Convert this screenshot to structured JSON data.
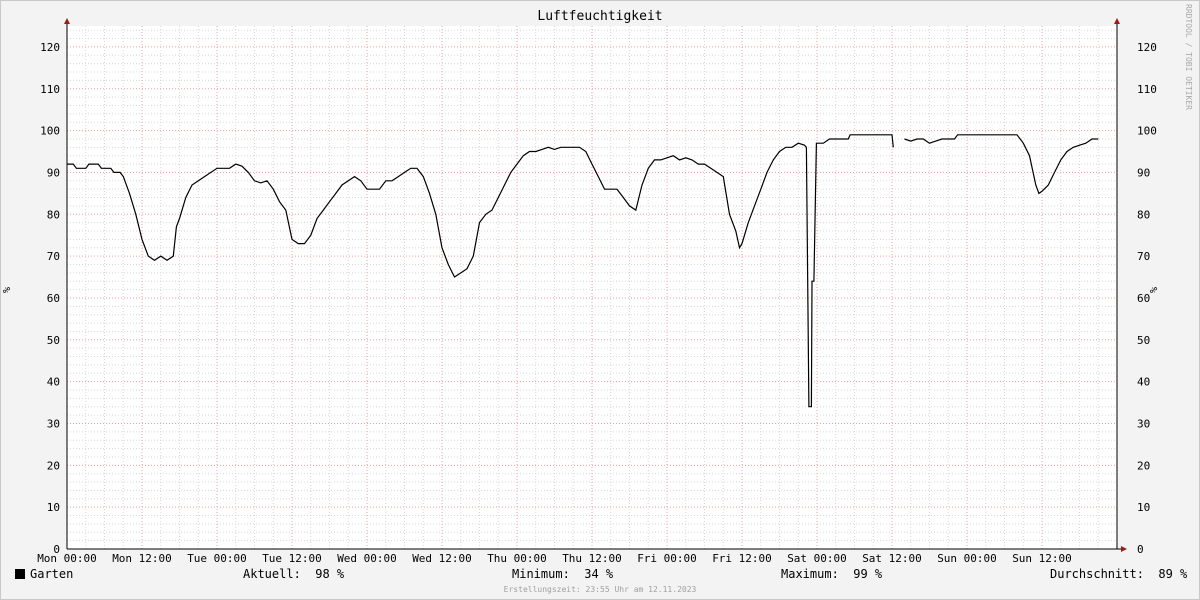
{
  "chart_data": {
    "type": "line",
    "title": "Luftfeuchtigkeit",
    "ylabel_left": "%",
    "ylabel_right": "%",
    "watermark": "RRDTOOL / TOBI OETIKER",
    "ylim": [
      0,
      125
    ],
    "yticks": [
      "0",
      "10",
      "20",
      "30",
      "40",
      "50",
      "60",
      "70",
      "80",
      "90",
      "100",
      "110",
      "120"
    ],
    "x_unit": "hours since Mon 00:00",
    "xlim": [
      0,
      168
    ],
    "xticks": [
      {
        "label": "Mon 00:00",
        "h": 0
      },
      {
        "label": "Mon 12:00",
        "h": 12
      },
      {
        "label": "Tue 00:00",
        "h": 24
      },
      {
        "label": "Tue 12:00",
        "h": 36
      },
      {
        "label": "Wed 00:00",
        "h": 48
      },
      {
        "label": "Wed 12:00",
        "h": 60
      },
      {
        "label": "Thu 00:00",
        "h": 72
      },
      {
        "label": "Thu 12:00",
        "h": 84
      },
      {
        "label": "Fri 00:00",
        "h": 96
      },
      {
        "label": "Fri 12:00",
        "h": 108
      },
      {
        "label": "Sat 00:00",
        "h": 120
      },
      {
        "label": "Sat 12:00",
        "h": 132
      },
      {
        "label": "Sun 00:00",
        "h": 144
      },
      {
        "label": "Sun 12:00",
        "h": 156
      }
    ],
    "grid": true,
    "line_color": "#000000",
    "series": [
      {
        "name": "Garten",
        "segments": [
          [
            [
              0,
              92
            ],
            [
              1,
              92
            ],
            [
              1.5,
              91
            ],
            [
              3,
              91
            ],
            [
              3.5,
              92
            ],
            [
              5,
              92
            ],
            [
              5.5,
              91
            ],
            [
              7,
              91
            ],
            [
              7.5,
              90
            ],
            [
              8.5,
              90
            ],
            [
              9,
              89
            ],
            [
              10,
              85
            ],
            [
              11,
              80
            ],
            [
              12,
              74
            ],
            [
              13,
              70
            ],
            [
              14,
              69
            ],
            [
              15,
              70
            ],
            [
              16,
              69
            ],
            [
              17,
              70
            ],
            [
              17.5,
              77
            ],
            [
              18,
              79
            ],
            [
              19,
              84
            ],
            [
              20,
              87
            ],
            [
              22,
              89
            ],
            [
              24,
              91
            ],
            [
              26,
              91
            ],
            [
              27,
              92
            ],
            [
              28,
              91.5
            ],
            [
              29,
              90
            ],
            [
              30,
              88
            ],
            [
              31,
              87.5
            ],
            [
              32,
              88
            ],
            [
              33,
              86
            ],
            [
              34,
              83
            ],
            [
              35,
              81
            ],
            [
              36,
              74
            ],
            [
              37,
              73
            ],
            [
              38,
              73
            ],
            [
              39,
              75
            ],
            [
              40,
              79
            ],
            [
              41,
              81
            ],
            [
              42,
              83
            ],
            [
              43,
              85
            ],
            [
              44,
              87
            ],
            [
              45,
              88
            ],
            [
              46,
              89
            ],
            [
              47,
              88
            ],
            [
              48,
              86
            ],
            [
              49,
              86
            ],
            [
              50,
              86
            ],
            [
              51,
              88
            ],
            [
              52,
              88
            ],
            [
              53,
              89
            ],
            [
              54,
              90
            ],
            [
              55,
              91
            ],
            [
              56,
              91
            ],
            [
              57,
              89
            ],
            [
              58,
              85
            ],
            [
              59,
              80
            ],
            [
              60,
              72
            ],
            [
              61,
              68
            ],
            [
              62,
              65
            ],
            [
              63,
              66
            ],
            [
              64,
              67
            ],
            [
              65,
              70
            ],
            [
              66,
              78
            ],
            [
              67,
              80
            ],
            [
              68,
              81
            ],
            [
              69,
              84
            ],
            [
              70,
              87
            ],
            [
              71,
              90
            ],
            [
              72,
              92
            ],
            [
              73,
              94
            ],
            [
              74,
              95
            ],
            [
              75,
              95
            ],
            [
              76,
              95.5
            ],
            [
              77,
              96
            ],
            [
              78,
              95.5
            ],
            [
              79,
              96
            ],
            [
              80,
              96
            ],
            [
              81,
              96
            ],
            [
              82,
              96
            ],
            [
              83,
              95
            ],
            [
              84,
              92
            ],
            [
              85,
              89
            ],
            [
              86,
              86
            ],
            [
              87,
              86
            ],
            [
              88,
              86
            ],
            [
              89,
              84
            ],
            [
              90,
              82
            ],
            [
              91,
              81
            ],
            [
              92,
              87
            ],
            [
              93,
              91
            ],
            [
              94,
              93
            ],
            [
              95,
              93
            ],
            [
              96,
              93.5
            ],
            [
              97,
              94
            ],
            [
              98,
              93
            ],
            [
              99,
              93.5
            ],
            [
              100,
              93
            ],
            [
              101,
              92
            ],
            [
              102,
              92
            ],
            [
              103,
              91
            ],
            [
              104,
              90
            ],
            [
              105,
              89
            ],
            [
              106,
              80
            ],
            [
              107,
              76
            ],
            [
              107.6,
              72
            ],
            [
              108,
              73
            ],
            [
              109,
              78
            ],
            [
              110,
              82
            ],
            [
              111,
              86
            ],
            [
              112,
              90
            ],
            [
              113,
              93
            ],
            [
              114,
              95
            ],
            [
              115,
              96
            ],
            [
              116,
              96
            ],
            [
              117,
              97
            ],
            [
              118,
              96.5
            ],
            [
              118.3,
              96
            ],
            [
              118.7,
              34
            ],
            [
              119.1,
              34
            ],
            [
              119.2,
              64
            ],
            [
              119.5,
              64
            ],
            [
              119.9,
              97
            ],
            [
              120.5,
              97
            ],
            [
              121,
              97
            ],
            [
              122,
              98
            ],
            [
              123,
              98
            ],
            [
              124,
              98
            ],
            [
              125,
              98
            ],
            [
              125.3,
              99
            ],
            [
              127,
              99
            ],
            [
              129,
              99
            ],
            [
              131,
              99
            ],
            [
              132,
              99
            ],
            [
              132.2,
              96
            ]
          ],
          [
            [
              134,
              98
            ],
            [
              135,
              97.5
            ],
            [
              136,
              98
            ],
            [
              137,
              98
            ],
            [
              138,
              97
            ],
            [
              139,
              97.5
            ],
            [
              140,
              98
            ],
            [
              141,
              98
            ],
            [
              142,
              98
            ],
            [
              142.5,
              99
            ],
            [
              145,
              99
            ],
            [
              148,
              99
            ],
            [
              151,
              99
            ],
            [
              152,
              99
            ],
            [
              153,
              97
            ],
            [
              154,
              94
            ],
            [
              155,
              87
            ],
            [
              155.5,
              85
            ],
            [
              156,
              85.5
            ],
            [
              157,
              87
            ],
            [
              158,
              90
            ],
            [
              159,
              93
            ],
            [
              160,
              95
            ],
            [
              161,
              96
            ],
            [
              162,
              96.5
            ],
            [
              163,
              97
            ],
            [
              164,
              98
            ],
            [
              165,
              98
            ]
          ]
        ]
      }
    ],
    "legend": {
      "label": "Garten",
      "current_label": "Aktuell:",
      "current_value": "98 %",
      "min_label": "Minimum:",
      "min_value": "34 %",
      "max_label": "Maximum:",
      "max_value": "99 %",
      "avg_label": "Durchschnitt:",
      "avg_value": "89 %"
    },
    "footer": "Erstellungszeit: 23:55 Uhr am 12.11.2023",
    "colors": {
      "background": "#f3f3f3",
      "canvas": "#ffffff",
      "minor_grid": "#d8d8d8",
      "major_grid": "#f0a0a0",
      "axis_arrow": "#9b1c1c",
      "line": "#000000"
    }
  }
}
